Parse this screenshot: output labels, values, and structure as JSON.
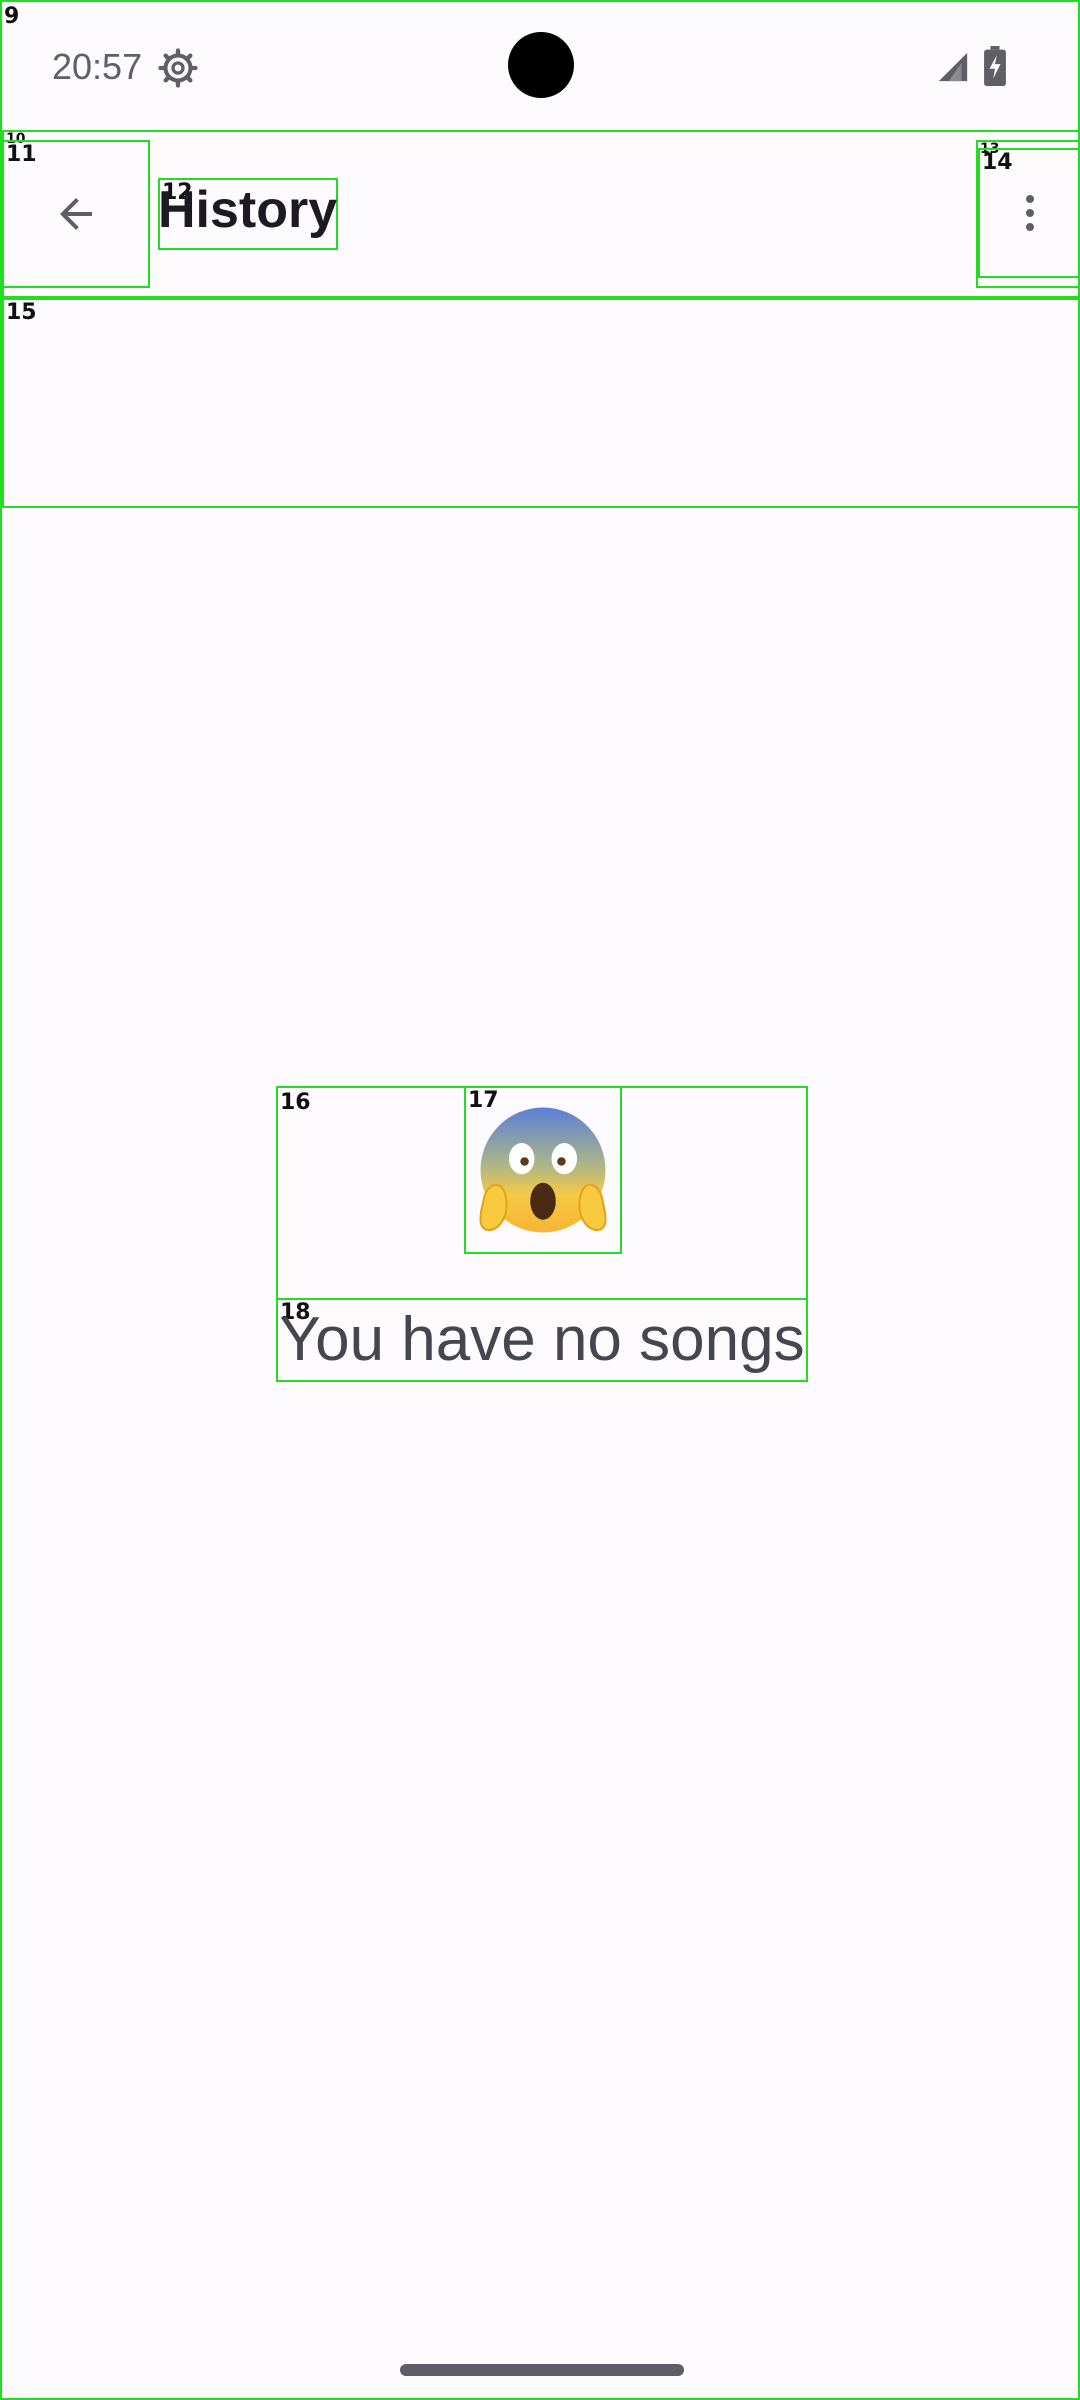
{
  "status_bar": {
    "time": "20:57",
    "icons": [
      "settings-gear-icon",
      "signal-icon",
      "battery-charging-icon"
    ]
  },
  "app_bar": {
    "back_icon": "arrow-back-icon",
    "title": "History",
    "menu_icon": "more-vert-icon"
  },
  "empty_state": {
    "emoji": "😱",
    "message": "You have no songs"
  },
  "overlay_labels": {
    "root": "9",
    "toolbar": "10",
    "back": "11",
    "title": "12",
    "menu_outer": "13",
    "menu": "14",
    "sub_bar": "15",
    "empty_container": "16",
    "emoji": "17",
    "message": "18"
  },
  "colors": {
    "background": "#fdfbfd",
    "title": "#1b1b21",
    "icon": "#5e5e66",
    "message": "#45464f",
    "overlay": "#22dd22"
  }
}
